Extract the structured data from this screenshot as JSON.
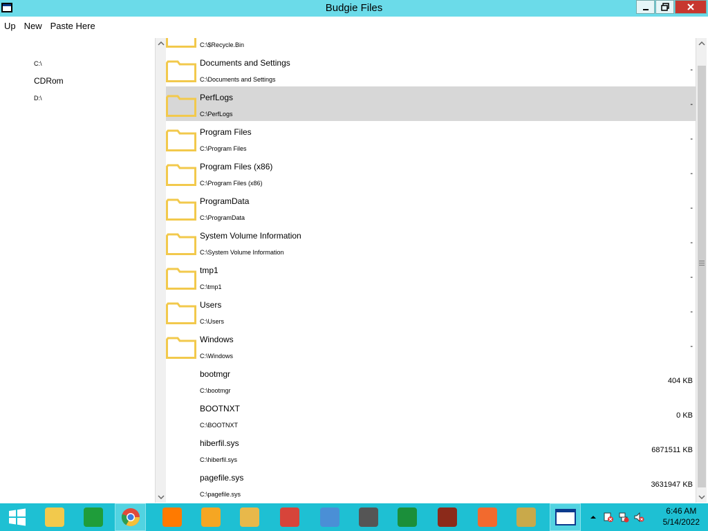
{
  "window": {
    "title": "Budgie Files"
  },
  "menu": {
    "up": "Up",
    "new": "New",
    "paste": "Paste Here"
  },
  "drives": [
    {
      "label": "C:\\",
      "size": "small"
    },
    {
      "label": "CDRom",
      "size": "large"
    },
    {
      "label": "D:\\",
      "size": "small"
    }
  ],
  "files": [
    {
      "name": "",
      "path": "C:\\$Recycle.Bin",
      "size": "",
      "type": "folder"
    },
    {
      "name": "Documents and Settings",
      "path": "C:\\Documents and Settings",
      "size": "-",
      "type": "folder"
    },
    {
      "name": "PerfLogs",
      "path": "C:\\PerfLogs",
      "size": "-",
      "type": "folder",
      "selected": true
    },
    {
      "name": "Program Files",
      "path": "C:\\Program Files",
      "size": "-",
      "type": "folder"
    },
    {
      "name": "Program Files (x86)",
      "path": "C:\\Program Files (x86)",
      "size": "-",
      "type": "folder"
    },
    {
      "name": "ProgramData",
      "path": "C:\\ProgramData",
      "size": "-",
      "type": "folder"
    },
    {
      "name": "System Volume Information",
      "path": "C:\\System Volume Information",
      "size": "-",
      "type": "folder"
    },
    {
      "name": "tmp1",
      "path": "C:\\tmp1",
      "size": "-",
      "type": "folder"
    },
    {
      "name": "Users",
      "path": "C:\\Users",
      "size": "-",
      "type": "folder"
    },
    {
      "name": "Windows",
      "path": "C:\\Windows",
      "size": "-",
      "type": "folder"
    },
    {
      "name": "bootmgr",
      "path": "C:\\bootmgr",
      "size": "404 KB",
      "type": "file"
    },
    {
      "name": "BOOTNXT",
      "path": "C:\\BOOTNXT",
      "size": "0 KB",
      "type": "file"
    },
    {
      "name": "hiberfil.sys",
      "path": "C:\\hiberfil.sys",
      "size": "6871511 KB",
      "type": "file"
    },
    {
      "name": "pagefile.sys",
      "path": "C:\\pagefile.sys",
      "size": "3631947 KB",
      "type": "file"
    }
  ],
  "taskbar": {
    "apps": [
      {
        "icon": "windows-start-icon",
        "color": "#ffffff"
      },
      {
        "icon": "file-explorer-icon",
        "color": "#f2c94c"
      },
      {
        "icon": "store-icon",
        "color": "#1f9d3a"
      },
      {
        "icon": "chrome-icon",
        "color": "#e04a3a",
        "active": true
      },
      {
        "icon": "firefox-icon",
        "color": "#ff7a00"
      },
      {
        "icon": "brave-icon",
        "color": "#f5a623"
      },
      {
        "icon": "archive-tool-icon",
        "color": "#e8b84a"
      },
      {
        "icon": "settings-tool-icon",
        "color": "#d7443a"
      },
      {
        "icon": "control-panel-icon",
        "color": "#4a8fd6"
      },
      {
        "icon": "server-manager-icon",
        "color": "#555555"
      },
      {
        "icon": "xbox-icon",
        "color": "#1b8f3a"
      },
      {
        "icon": "game-icon",
        "color": "#8b2a1a"
      },
      {
        "icon": "swift-icon",
        "color": "#f26a2e"
      },
      {
        "icon": "zip-icon",
        "color": "#c9a94a"
      },
      {
        "icon": "budgie-files-window-icon",
        "color": "#ffffff",
        "active": true
      }
    ],
    "clock": {
      "time": "6:46 AM",
      "date": "5/14/2022"
    }
  }
}
